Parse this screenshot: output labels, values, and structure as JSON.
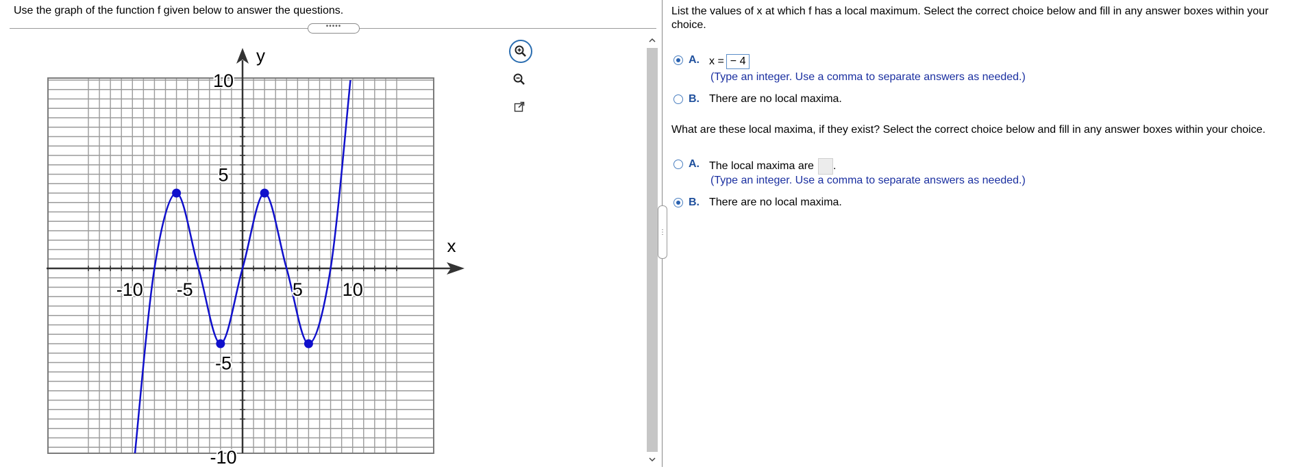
{
  "left": {
    "instruction": "Use the graph of the function f given below to answer the questions.",
    "collapse_handle": "•••••"
  },
  "chart_data": {
    "type": "line",
    "xlabel": "x",
    "ylabel": "y",
    "xlim": [
      -14,
      14
    ],
    "ylim": [
      -10,
      10
    ],
    "x_ticks": [
      -10,
      -5,
      5,
      10
    ],
    "y_ticks": [
      -10,
      -5,
      5,
      10
    ],
    "x_tick_labels": [
      "-10",
      "-5",
      "5",
      "10"
    ],
    "y_tick_labels": [
      "-10",
      "-5",
      "5",
      "10"
    ],
    "grid": true,
    "curve_color": "#1010cc",
    "marked_points": [
      {
        "x": -6,
        "y": 4
      },
      {
        "x": -2,
        "y": -4
      },
      {
        "x": 2,
        "y": 4
      },
      {
        "x": 6,
        "y": -4
      }
    ],
    "curve_points": [
      {
        "x": -9.8,
        "y": -10
      },
      {
        "x": -8,
        "y": 0
      },
      {
        "x": -6,
        "y": 4
      },
      {
        "x": -4,
        "y": 0
      },
      {
        "x": -2,
        "y": -4
      },
      {
        "x": 0,
        "y": 0
      },
      {
        "x": 2,
        "y": 4
      },
      {
        "x": 4,
        "y": 0
      },
      {
        "x": 6,
        "y": -4
      },
      {
        "x": 8,
        "y": 0
      },
      {
        "x": 9.8,
        "y": 10
      }
    ]
  },
  "tools": {
    "zoom_in_icon": "zoom-in-icon",
    "zoom_out_icon": "zoom-out-icon",
    "popout_icon": "popout-icon"
  },
  "questions": {
    "q1": {
      "prompt": "List the values of x at which f has a local maximum. Select the correct choice below and fill in any answer boxes within your choice.",
      "choices": [
        {
          "letter": "A.",
          "prefix": "x =",
          "answer": "− 4",
          "hint": "(Type an integer. Use a comma to separate answers as needed.)",
          "selected": true
        },
        {
          "letter": "B.",
          "text": "There are no local maxima.",
          "selected": false
        }
      ]
    },
    "q2": {
      "prompt": "What are these local maxima, if they exist? Select the correct choice below and fill in any answer boxes within your choice.",
      "choices": [
        {
          "letter": "A.",
          "text": "The local maxima are",
          "suffix": ".",
          "hint": "(Type an integer. Use a comma to separate answers as needed.)",
          "selected": false
        },
        {
          "letter": "B.",
          "text": "There are no local maxima.",
          "selected": true
        }
      ]
    }
  },
  "colors": {
    "accent": "#1e4f9c",
    "hint_text": "#1a2fa0",
    "curve": "#1010cc"
  }
}
